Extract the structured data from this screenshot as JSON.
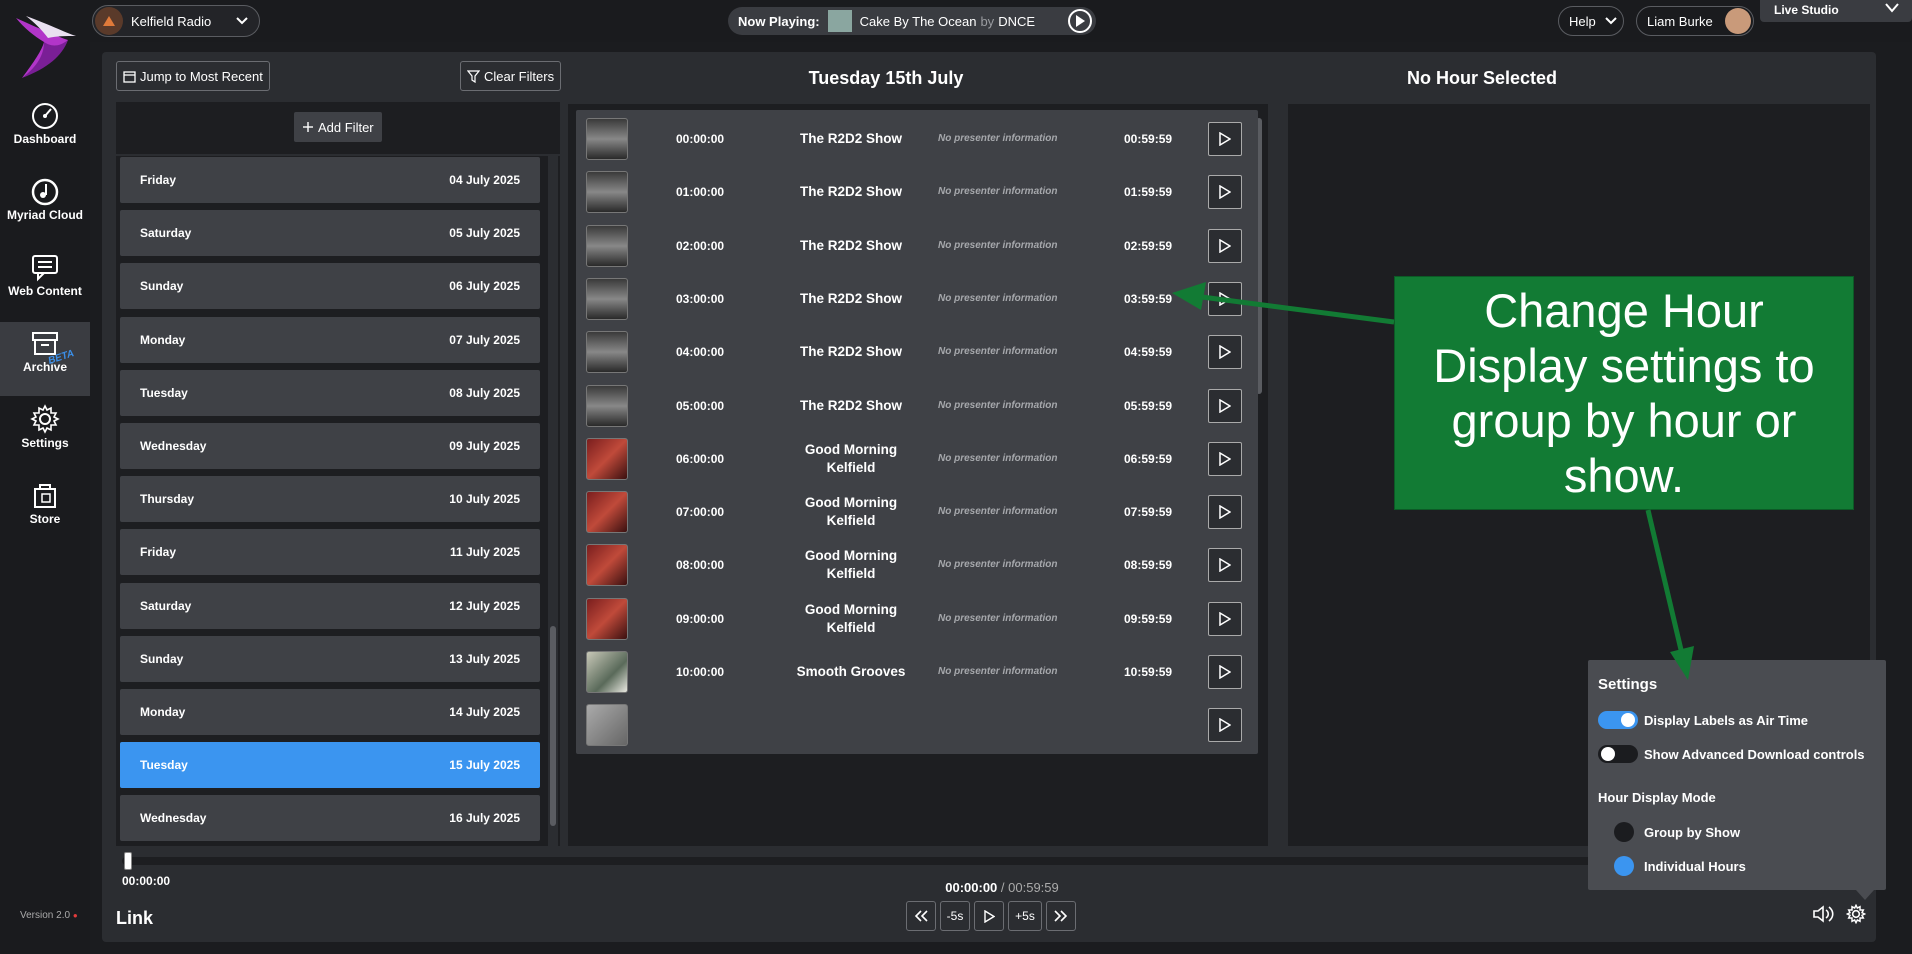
{
  "sidebar": {
    "items": [
      {
        "label": "Dashboard",
        "icon": "gauge-icon"
      },
      {
        "label": "Myriad Cloud",
        "icon": "cloud-disc-icon"
      },
      {
        "label": "Web Content",
        "icon": "chat-icon"
      },
      {
        "label": "Archive",
        "icon": "archive-icon",
        "badge": "BETA"
      },
      {
        "label": "Settings",
        "icon": "gear-icon"
      },
      {
        "label": "Store",
        "icon": "store-icon"
      }
    ],
    "version": "Version 2.0"
  },
  "topbar": {
    "station": "Kelfield Radio",
    "now_playing_label": "Now Playing:",
    "track": "Cake By The Ocean",
    "by": "by",
    "artist": "DNCE",
    "help": "Help",
    "user": "Liam Burke",
    "studio": "Live Studio"
  },
  "toolbar": {
    "jump": "Jump to Most Recent",
    "clear": "Clear Filters",
    "add_filter": "Add Filter"
  },
  "date_header": "Tuesday 15th July",
  "hour_header": "No Hour Selected",
  "days": [
    {
      "day": "Friday",
      "date": "04 July 2025"
    },
    {
      "day": "Saturday",
      "date": "05 July 2025"
    },
    {
      "day": "Sunday",
      "date": "06 July 2025"
    },
    {
      "day": "Monday",
      "date": "07 July 2025"
    },
    {
      "day": "Tuesday",
      "date": "08 July 2025"
    },
    {
      "day": "Wednesday",
      "date": "09 July 2025"
    },
    {
      "day": "Thursday",
      "date": "10 July 2025"
    },
    {
      "day": "Friday",
      "date": "11 July 2025"
    },
    {
      "day": "Saturday",
      "date": "12 July 2025"
    },
    {
      "day": "Sunday",
      "date": "13 July 2025"
    },
    {
      "day": "Monday",
      "date": "14 July 2025"
    },
    {
      "day": "Tuesday",
      "date": "15 July 2025"
    },
    {
      "day": "Wednesday",
      "date": "16 July 2025"
    }
  ],
  "hours": [
    {
      "start": "00:00:00",
      "show": "The R2D2 Show",
      "presenter": "No presenter information",
      "end": "00:59:59"
    },
    {
      "start": "01:00:00",
      "show": "The R2D2 Show",
      "presenter": "No presenter information",
      "end": "01:59:59"
    },
    {
      "start": "02:00:00",
      "show": "The R2D2 Show",
      "presenter": "No presenter information",
      "end": "02:59:59"
    },
    {
      "start": "03:00:00",
      "show": "The R2D2 Show",
      "presenter": "No presenter information",
      "end": "03:59:59"
    },
    {
      "start": "04:00:00",
      "show": "The R2D2 Show",
      "presenter": "No presenter information",
      "end": "04:59:59"
    },
    {
      "start": "05:00:00",
      "show": "The R2D2 Show",
      "presenter": "No presenter information",
      "end": "05:59:59"
    },
    {
      "start": "06:00:00",
      "show": "Good Morning Kelfield",
      "presenter": "No presenter information",
      "end": "06:59:59"
    },
    {
      "start": "07:00:00",
      "show": "Good Morning Kelfield",
      "presenter": "No presenter information",
      "end": "07:59:59"
    },
    {
      "start": "08:00:00",
      "show": "Good Morning Kelfield",
      "presenter": "No presenter information",
      "end": "08:59:59"
    },
    {
      "start": "09:00:00",
      "show": "Good Morning Kelfield",
      "presenter": "No presenter information",
      "end": "09:59:59"
    },
    {
      "start": "10:00:00",
      "show": "Smooth Grooves",
      "presenter": "No presenter information",
      "end": "10:59:59"
    },
    {
      "start": "",
      "show": "",
      "presenter": "",
      "end": ""
    }
  ],
  "player": {
    "position": "00:00:00",
    "current": "00:00:00",
    "separator": " / ",
    "total": "00:59:59",
    "link": "Link",
    "back5": "-5s",
    "fwd5": "+5s"
  },
  "settings": {
    "title": "Settings",
    "labels_air_time": "Display Labels as Air Time",
    "labels_air_time_on": true,
    "advanced_download": "Show Advanced Download controls",
    "advanced_download_on": false,
    "hour_mode_title": "Hour Display Mode",
    "group_by_show": "Group by Show",
    "individual_hours": "Individual Hours",
    "selected_mode": "Individual Hours"
  },
  "callout": "Change Hour Display settings to group by hour or show.",
  "colors": {
    "accent": "#3b95f0",
    "callout": "#127b34",
    "panel": "#2b2d31"
  }
}
